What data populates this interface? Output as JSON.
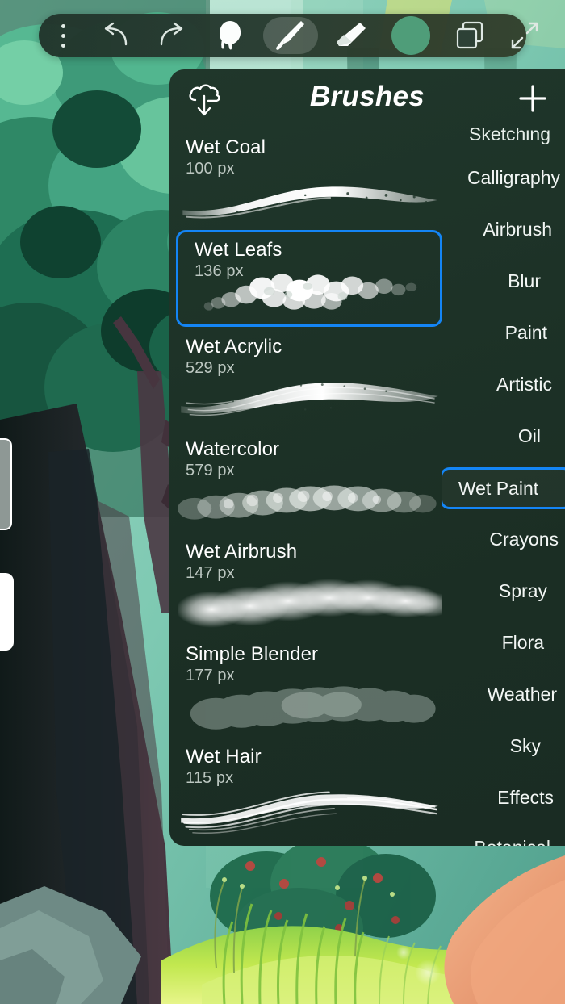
{
  "app": {
    "background_description": "digital painting of a forest scene with tree foliage, trunk, grass and character"
  },
  "toolbar": {
    "items": [
      {
        "name": "menu",
        "icon": "three-dots-icon",
        "selected": false
      },
      {
        "name": "undo",
        "icon": "undo-arrow-icon",
        "selected": false
      },
      {
        "name": "redo",
        "icon": "redo-arrow-icon",
        "selected": false
      },
      {
        "name": "smudge",
        "icon": "smudge-finger-icon",
        "selected": false
      },
      {
        "name": "brush",
        "icon": "paintbrush-icon",
        "selected": true
      },
      {
        "name": "eraser",
        "icon": "eraser-icon",
        "selected": false
      },
      {
        "name": "color",
        "icon": "color-swatch-icon",
        "selected": false
      },
      {
        "name": "layers",
        "icon": "layers-icon",
        "selected": false
      },
      {
        "name": "fullscreen",
        "icon": "expand-arrows-icon",
        "selected": false
      }
    ],
    "color_swatch_hex": "#4c9c79"
  },
  "panel": {
    "title": "Brushes",
    "import_icon": "cloud-download-icon",
    "add_icon": "plus-icon",
    "accent_hex": "#1485f5",
    "background_hex": "#1d3227"
  },
  "brushes": [
    {
      "name": "Wet Coal",
      "size": "100 px",
      "selected": false,
      "stroke": "coal"
    },
    {
      "name": "Wet Leafs",
      "size": "136 px",
      "selected": true,
      "stroke": "leafs"
    },
    {
      "name": "Wet Acrylic",
      "size": "529 px",
      "selected": false,
      "stroke": "acrylic"
    },
    {
      "name": "Watercolor",
      "size": "579 px",
      "selected": false,
      "stroke": "watercolor"
    },
    {
      "name": "Wet Airbrush",
      "size": "147 px",
      "selected": false,
      "stroke": "airbrush"
    },
    {
      "name": "Simple Blender",
      "size": "177 px",
      "selected": false,
      "stroke": "blender"
    },
    {
      "name": "Wet Hair",
      "size": "115 px",
      "selected": false,
      "stroke": "hair"
    }
  ],
  "categories": [
    {
      "label": "Sketching",
      "selected": false,
      "clipped": true
    },
    {
      "label": "Calligraphy",
      "selected": false,
      "clipped": false
    },
    {
      "label": "Airbrush",
      "selected": false,
      "clipped": false
    },
    {
      "label": "Blur",
      "selected": false,
      "clipped": false
    },
    {
      "label": "Paint",
      "selected": false,
      "clipped": false
    },
    {
      "label": "Artistic",
      "selected": false,
      "clipped": false
    },
    {
      "label": "Oil",
      "selected": false,
      "clipped": false
    },
    {
      "label": "Wet Paint",
      "selected": true,
      "clipped": false
    },
    {
      "label": "Crayons",
      "selected": false,
      "clipped": false
    },
    {
      "label": "Spray",
      "selected": false,
      "clipped": false
    },
    {
      "label": "Flora",
      "selected": false,
      "clipped": false
    },
    {
      "label": "Weather",
      "selected": false,
      "clipped": false
    },
    {
      "label": "Sky",
      "selected": false,
      "clipped": false
    },
    {
      "label": "Effects",
      "selected": false,
      "clipped": false
    },
    {
      "label": "Botanical",
      "selected": false,
      "clipped": true
    }
  ],
  "sliders": [
    {
      "name": "brush-size-slider",
      "handle_hex": "#8e9895"
    },
    {
      "name": "brush-opacity-slider",
      "handle_hex": "#ffffff"
    }
  ]
}
